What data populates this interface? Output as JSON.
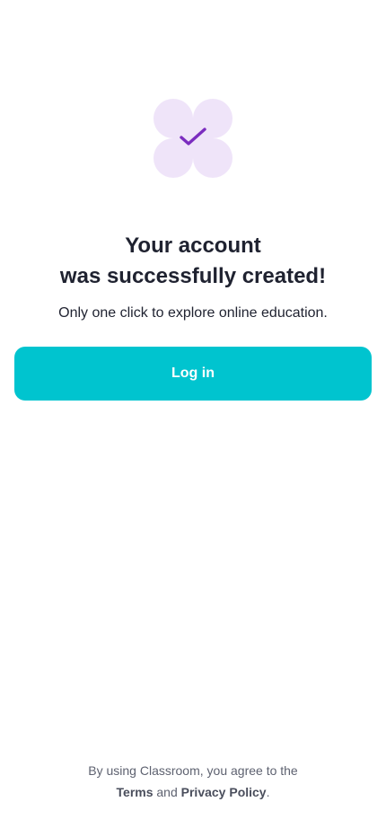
{
  "colors": {
    "accent": "#00c4cf",
    "badge_background": "#efe4f9",
    "check": "#7b2cbf"
  },
  "badge": {
    "icon": "checkmark-icon"
  },
  "heading": {
    "line1": "Your account",
    "line2": "was successfully created!"
  },
  "subtitle": "Only one click to explore online education.",
  "login_button": {
    "label": "Log in"
  },
  "footer": {
    "line1": "By using Classroom, you agree to the",
    "terms_link": "Terms",
    "and_text": "and",
    "privacy_link": "Privacy Policy",
    "period": "."
  }
}
